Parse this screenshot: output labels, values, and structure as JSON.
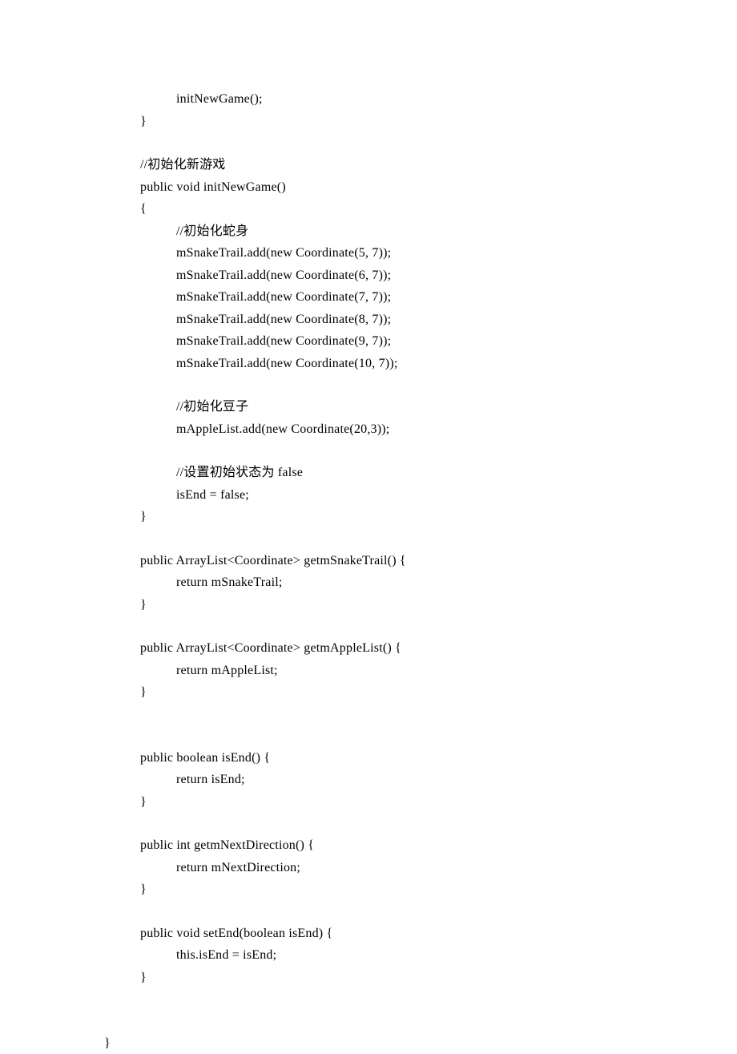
{
  "lines": [
    {
      "indent": 1,
      "text": "initNewGame();"
    },
    {
      "indent": 0,
      "text": "}"
    },
    {
      "blank": true
    },
    {
      "indent": 0,
      "text": "//初始化新游戏"
    },
    {
      "indent": 0,
      "text": "public void initNewGame()"
    },
    {
      "indent": 0,
      "text": "{"
    },
    {
      "indent": 1,
      "text": "//初始化蛇身"
    },
    {
      "indent": 1,
      "text": "mSnakeTrail.add(new Coordinate(5, 7));"
    },
    {
      "indent": 1,
      "text": "mSnakeTrail.add(new Coordinate(6, 7));"
    },
    {
      "indent": 1,
      "text": "mSnakeTrail.add(new Coordinate(7, 7));"
    },
    {
      "indent": 1,
      "text": "mSnakeTrail.add(new Coordinate(8, 7));"
    },
    {
      "indent": 1,
      "text": "mSnakeTrail.add(new Coordinate(9, 7));"
    },
    {
      "indent": 1,
      "text": "mSnakeTrail.add(new Coordinate(10, 7));"
    },
    {
      "blank": true
    },
    {
      "indent": 1,
      "text": "//初始化豆子"
    },
    {
      "indent": 1,
      "text": "mAppleList.add(new Coordinate(20,3));"
    },
    {
      "blank": true
    },
    {
      "indent": 1,
      "text": "//设置初始状态为 false"
    },
    {
      "indent": 1,
      "text": "isEnd = false;"
    },
    {
      "indent": 0,
      "text": "}"
    },
    {
      "blank": true
    },
    {
      "indent": 0,
      "text": "public ArrayList<Coordinate> getmSnakeTrail() {"
    },
    {
      "indent": 1,
      "text": "return mSnakeTrail;"
    },
    {
      "indent": 0,
      "text": "}"
    },
    {
      "blank": true
    },
    {
      "indent": 0,
      "text": "public ArrayList<Coordinate> getmAppleList() {"
    },
    {
      "indent": 1,
      "text": "return mAppleList;"
    },
    {
      "indent": 0,
      "text": "}"
    },
    {
      "blank": true
    },
    {
      "blank": true
    },
    {
      "indent": 0,
      "text": "public boolean isEnd() {"
    },
    {
      "indent": 1,
      "text": "return isEnd;"
    },
    {
      "indent": 0,
      "text": "}"
    },
    {
      "blank": true
    },
    {
      "indent": 0,
      "text": "public int getmNextDirection() {"
    },
    {
      "indent": 1,
      "text": "return mNextDirection;"
    },
    {
      "indent": 0,
      "text": "}"
    },
    {
      "blank": true
    },
    {
      "indent": 0,
      "text": "public void setEnd(boolean isEnd) {"
    },
    {
      "indent": 1,
      "text": "this.isEnd = isEnd;"
    },
    {
      "indent": 0,
      "text": "}"
    },
    {
      "blank": true
    },
    {
      "blank": true
    },
    {
      "indent": -1,
      "text": "}"
    }
  ]
}
